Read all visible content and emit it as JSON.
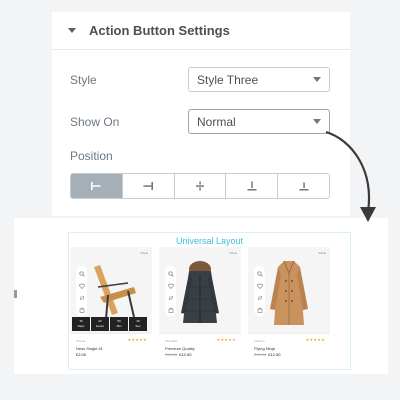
{
  "panel": {
    "title": "Action Button Settings",
    "style_label": "Style",
    "style_value": "Style Three",
    "show_on_label": "Show On",
    "show_on_value": "Normal",
    "position_label": "Position",
    "position_options": [
      "align-left-icon",
      "align-right-icon",
      "align-center-icon",
      "align-bottom-icon",
      "align-bottom-alt-icon"
    ],
    "position_selected_index": 0
  },
  "preview": {
    "title": "Universal Layout",
    "products": [
      {
        "badge": "SALE",
        "brand": "Woods",
        "name": "Ness Single #1",
        "old_price": "",
        "price": "£2.00",
        "countdown": [
          {
            "value": "TA",
            "unit": "Days"
          },
          {
            "value": "22",
            "unit": "Hours"
          },
          {
            "value": "59",
            "unit": "Min"
          },
          {
            "value": "30",
            "unit": "Sec"
          }
        ]
      },
      {
        "badge": "SALE",
        "brand": "WoodEst",
        "name": "Premium Quality",
        "old_price": "£18.00",
        "price": "£12.00"
      },
      {
        "badge": "SALE",
        "brand": "Fashion",
        "name": "Flying Ninja",
        "old_price": "£18.00",
        "price": "£12.00"
      }
    ]
  },
  "colors": {
    "accent": "#40bfdc",
    "selected": "#a4afb7",
    "star": "#f5a623"
  }
}
